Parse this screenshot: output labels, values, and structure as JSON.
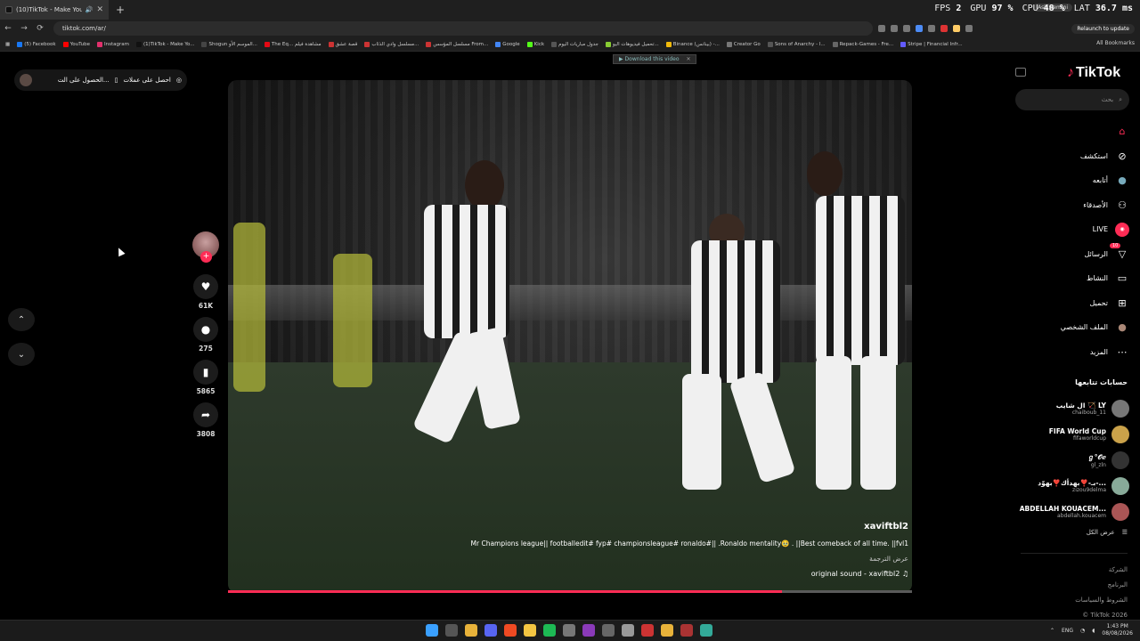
{
  "browser": {
    "tab_title": "(10)TikTok - Make Your Day",
    "url": "tiktok.com/ar/",
    "relaunch_label": "Relaunch to update",
    "ask_gemini": "Ask Gemini",
    "all_bookmarks": "All Bookmarks",
    "perf": {
      "fps_label": "FPS",
      "fps": "2",
      "gpu_label": "GPU",
      "gpu": "97 %",
      "cpu_label": "CPU",
      "cpu": "48 %",
      "lat_label": "LAT",
      "lat": "36.7 ms"
    },
    "bookmarks": [
      "(5) Facebook",
      "YouTube",
      "Instagram",
      "(1)TikTok - Make Yo...",
      "Shogun الموسم الأو...",
      "The Eq... مشاهدة فيلم",
      "قصة عشق",
      "مسلسل وادي الذئاب...",
      "مسلسل المؤسس From...",
      "Google",
      "Kick",
      "جدول مباريات اليوم",
      "تحميل فيديوهات اليو...",
      "Binance (بينانس) -...",
      "Creator Go",
      "Sons of Anarchy - ا...",
      "Repack-Games - Fre...",
      "Stripe | Financial Infr..."
    ]
  },
  "top_card": {
    "left_label": "احصل على عملات",
    "right_label": "الحصول على الت..."
  },
  "download_bar": "Download this video",
  "video": {
    "username": "xaviftbl2",
    "description": "Mr Champions league|| footballedit# fyp# championsleague# ronaldo#|| .Ronaldo mentality🥹 . ||Best comeback of all time. ||fvl1",
    "translate": "عرض الترجمة",
    "sound": "original sound - xaviftbl2",
    "progress": 0.81
  },
  "actions": {
    "likes": "61K",
    "comments": "275",
    "saves": "5865",
    "shares": "3808"
  },
  "sidebar": {
    "logo": "TikTok",
    "search_placeholder": "بحث",
    "nav": [
      {
        "label": "",
        "icon": "home-icon"
      },
      {
        "label": "استكشف",
        "icon": "compass-icon"
      },
      {
        "label": "أتابعه",
        "icon": "avatar-icon"
      },
      {
        "label": "الأصدقاء",
        "icon": "friends-icon"
      },
      {
        "label": "LIVE",
        "icon": "live-icon"
      },
      {
        "label": "الرسائل",
        "icon": "send-icon"
      },
      {
        "label": "النشاط",
        "icon": "inbox-icon"
      },
      {
        "label": "تحميل",
        "icon": "upload-icon"
      },
      {
        "label": "الملف الشخصي",
        "icon": "profile-icon"
      },
      {
        "label": "المزيد",
        "icon": "more-icon"
      }
    ],
    "messages_badge": "10",
    "following_title": "حسابات تتابعها",
    "following": [
      {
        "name": "ال شايب 🏹 LY",
        "user": "chaiboub_11"
      },
      {
        "name": "FIFA World Cup",
        "user": "fifaworldcup"
      },
      {
        "name": "ℊ°𝒪ℯ",
        "user": "gl_zln"
      },
      {
        "name": "بـ-❣️بهدأك❣️بهوّد-... ",
        "user": "zizou9delma"
      },
      {
        "name": "ABDELLAH KOUACEM...",
        "user": "abdellah.kouacem"
      }
    ],
    "show_all": "عرض الكل",
    "footer": [
      "الشركة",
      "البرنامج",
      "الشروط والسياسات",
      "© TikTok 2026"
    ]
  },
  "taskbar": {
    "lang": "ENG",
    "time": "1:43 PM",
    "date": "08/08/2026"
  }
}
